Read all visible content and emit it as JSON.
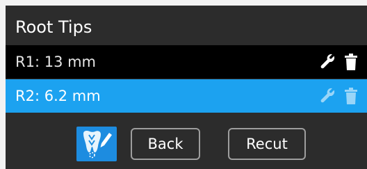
{
  "panel": {
    "title": "Root Tips"
  },
  "roots": [
    {
      "label": "R1: 13 mm",
      "selected": false
    },
    {
      "label": "R2: 6.2 mm",
      "selected": true
    }
  ],
  "actions": {
    "tooth_tool_icon": "tooth-pencil-icon",
    "back_label": "Back",
    "recut_label": "Recut"
  },
  "colors": {
    "panel_bg": "#2c2c2c",
    "row_bg": "#000000",
    "selected_bg": "#1ca2f0",
    "tool_button_bg": "#1d8ce0",
    "button_border": "#9e9e9e"
  }
}
